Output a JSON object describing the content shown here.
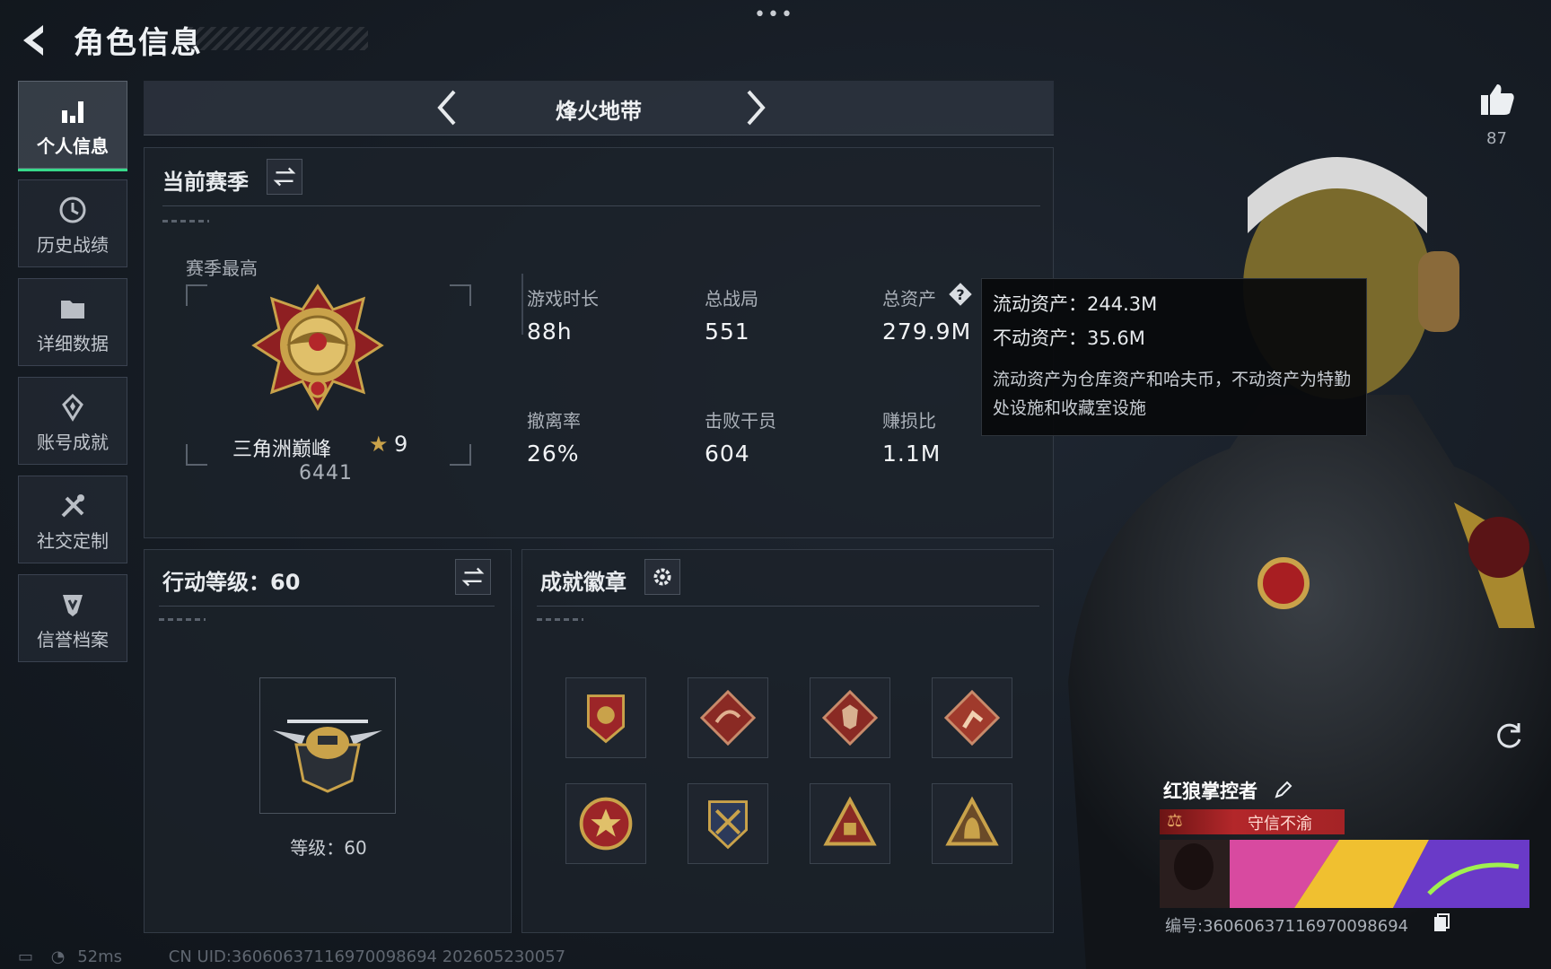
{
  "header": {
    "title": "角色信息",
    "more": "•••"
  },
  "sidebar": {
    "items": [
      {
        "label": "个人信息",
        "icon": "bar-chart-icon",
        "active": true
      },
      {
        "label": "历史战绩",
        "icon": "history-icon",
        "active": false
      },
      {
        "label": "详细数据",
        "icon": "folder-icon",
        "active": false
      },
      {
        "label": "账号成就",
        "icon": "achievement-icon",
        "active": false
      },
      {
        "label": "社交定制",
        "icon": "tools-icon",
        "active": false
      },
      {
        "label": "信誉档案",
        "icon": "credit-shield-icon",
        "active": false
      }
    ]
  },
  "mode": {
    "title": "烽火地带"
  },
  "season": {
    "title": "当前赛季",
    "best_label": "赛季最高",
    "rank_name": "三角洲巅峰",
    "rank_stars": "9",
    "rank_score": "6441",
    "stats": [
      {
        "label": "游戏时长",
        "value": "88h"
      },
      {
        "label": "总战局",
        "value": "551"
      },
      {
        "label": "总资产",
        "value": "279.9M"
      },
      {
        "label": "撤离率",
        "value": "26%"
      },
      {
        "label": "击败干员",
        "value": "604"
      },
      {
        "label": "赚损比",
        "value": "1.1M"
      }
    ]
  },
  "tooltip": {
    "liquid": "流动资产：244.3M",
    "fixed": "不动资产：35.6M",
    "description": "流动资产为仓库资产和哈夫币，不动资产为特勤处设施和收藏室设施"
  },
  "level": {
    "title": "行动等级：60",
    "caption": "等级：60"
  },
  "badges": {
    "title": "成就徽章",
    "items": [
      "badge-eagle-shield",
      "badge-dragon",
      "badge-wolf",
      "badge-runner",
      "badge-star-medal",
      "badge-crossed-shield",
      "badge-pyramid",
      "badge-bag"
    ]
  },
  "profile": {
    "likes": "87",
    "name": "红狼掌控者",
    "title_badge": "守信不渝",
    "player_id": "编号:360606371169700986​94"
  },
  "status": {
    "ping": "52ms",
    "uid": "CN UID:3606063711697009869​4 202605230057"
  },
  "colors": {
    "accent_green": "#37d98a",
    "badge_red": "#b3272a",
    "gold": "#c9a24a"
  }
}
